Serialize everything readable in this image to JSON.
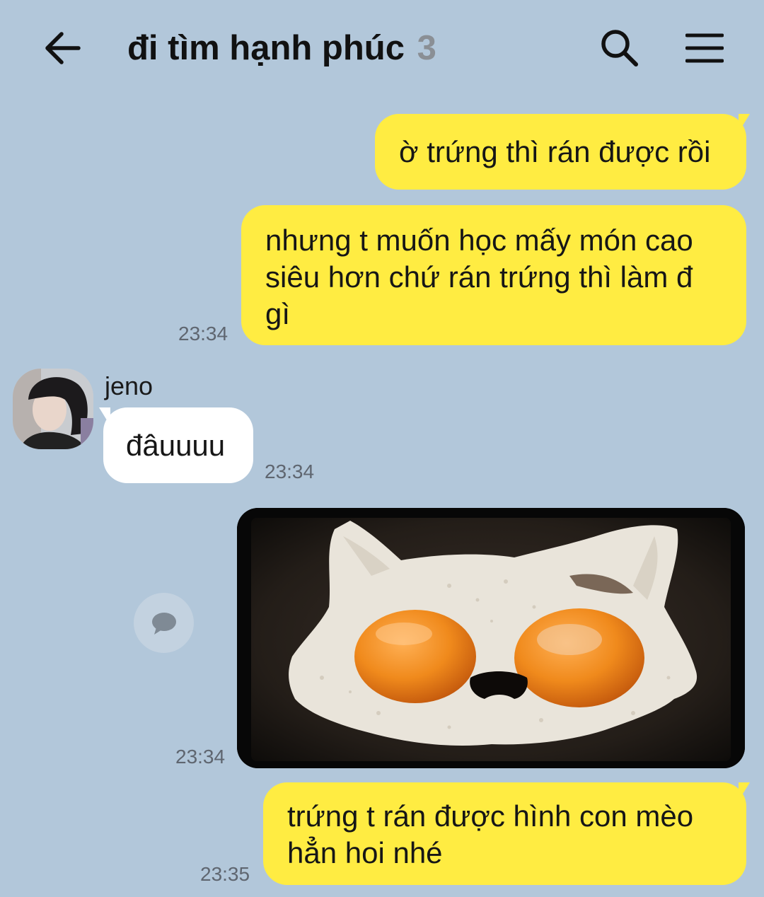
{
  "header": {
    "title": "đi tìm hạnh phúc",
    "member_count": "3",
    "back_icon": "arrow-left-icon",
    "search_icon": "search-icon",
    "menu_icon": "hamburger-menu-icon"
  },
  "messages": [
    {
      "direction": "outgoing",
      "lines": [
        "ờ trứng thì rán được rồi"
      ],
      "time": ""
    },
    {
      "direction": "outgoing",
      "lines": [
        "nhưng t muốn học mấy món cao",
        "siêu hơn chứ rán trứng thì làm đ",
        "gì"
      ],
      "time": "23:34"
    },
    {
      "direction": "incoming",
      "sender": "jeno",
      "lines": [
        "đâuuuu"
      ],
      "time": "23:34"
    },
    {
      "direction": "outgoing",
      "type": "image",
      "image_subject": "fried eggs shaped like a cat face",
      "time": "23:34"
    },
    {
      "direction": "outgoing",
      "lines": [
        "trứng t rán được hình con mèo",
        "hẳn hoi nhé"
      ],
      "time": "23:35"
    }
  ],
  "colors": {
    "background": "#b2c7da",
    "outgoing_bubble": "#ffec42",
    "incoming_bubble": "#ffffff",
    "timestamp": "#5f6670",
    "member_count": "#8a8f95"
  }
}
